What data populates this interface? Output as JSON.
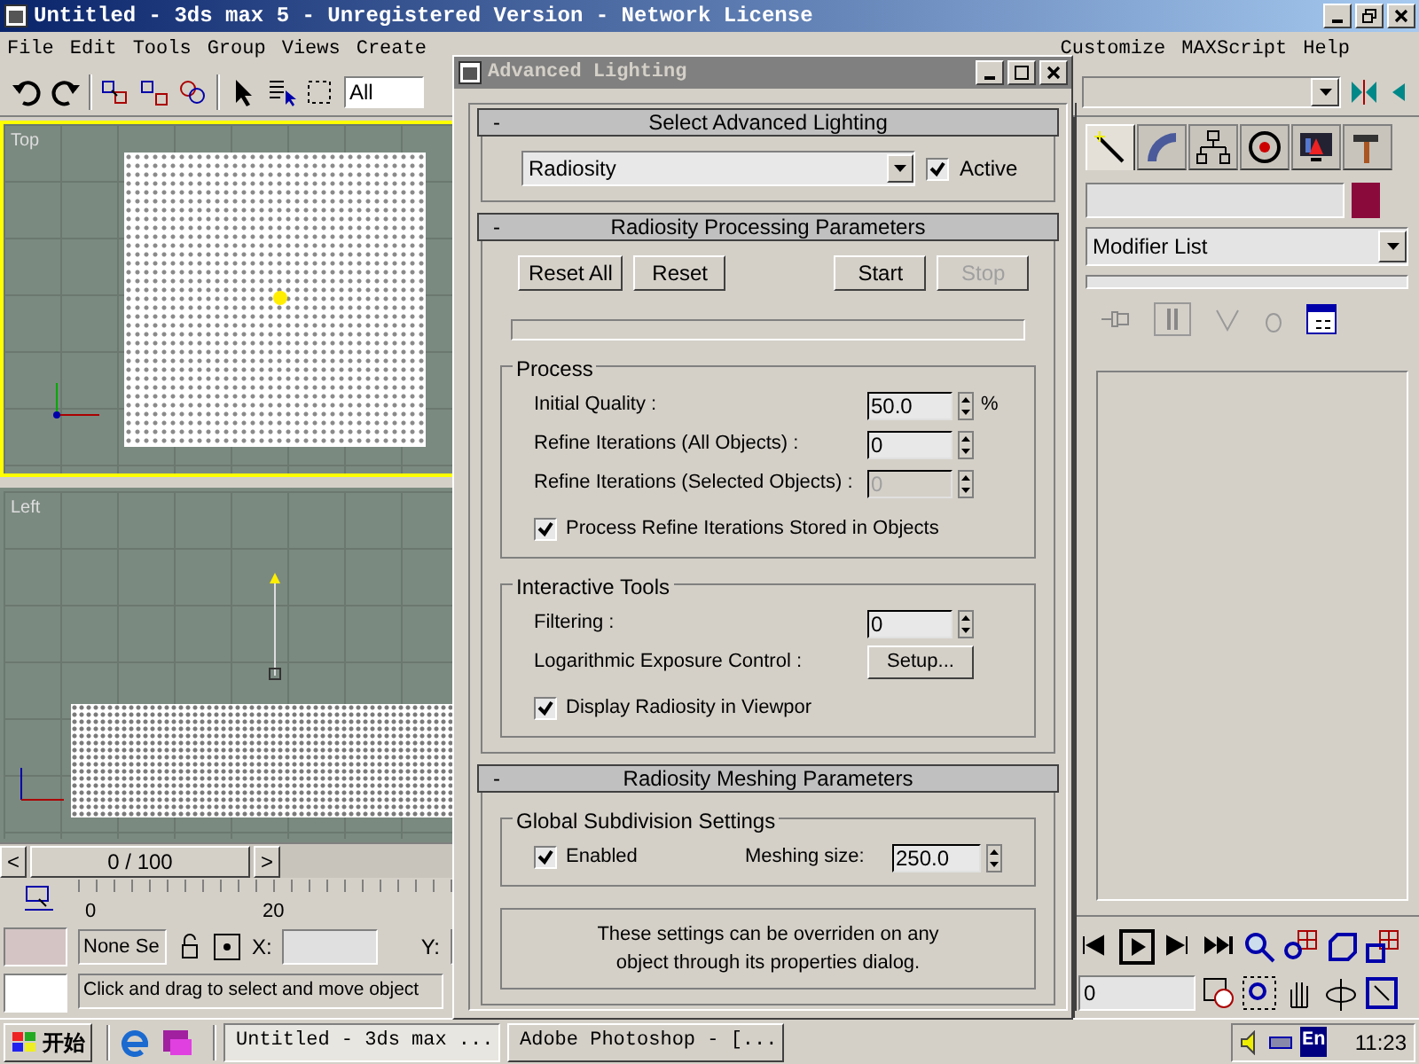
{
  "window": {
    "title": "Untitled - 3ds max 5 - Unregistered Version - Network License"
  },
  "menu": [
    "File",
    "Edit",
    "Tools",
    "Group",
    "Views",
    "Create",
    "Customize",
    "MAXScript",
    "Help"
  ],
  "toolbar": {
    "selection_filter": "All"
  },
  "viewports": [
    {
      "label": "Top",
      "selected": true
    },
    {
      "label": "Left",
      "selected": false
    }
  ],
  "time_slider": {
    "prev": "<",
    "position": "0 / 100",
    "next": ">"
  },
  "track_bar": {
    "ticks": [
      "0",
      "20"
    ]
  },
  "status": {
    "selection": "None Se",
    "x_label": "X:",
    "y_label": "Y:",
    "prompt": "Click and drag to select and move object"
  },
  "command_panel": {
    "tabs": [
      {
        "selected": true
      },
      {
        "selected": false
      },
      {
        "selected": false
      },
      {
        "selected": false
      },
      {
        "selected": false
      },
      {
        "selected": false
      }
    ],
    "modifier_list": "Modifier List"
  },
  "anim_controls": {
    "frame": "0"
  },
  "dialog": {
    "title": "Advanced Lighting",
    "rollouts": [
      {
        "collapse": "-",
        "title": "Select Advanced Lighting",
        "plugin": "Radiosity",
        "active": {
          "label": "Active",
          "checked": true
        }
      },
      {
        "collapse": "-",
        "title": "Radiosity Processing Parameters",
        "buttons": [
          {
            "label": "Reset All",
            "disabled": false
          },
          {
            "label": "Reset",
            "disabled": false
          },
          {
            "label": "Start",
            "disabled": false
          },
          {
            "label": "Stop",
            "disabled": true
          }
        ],
        "progress": {
          "level": 0
        },
        "groups": [
          {
            "title": "Process",
            "rows": [
              {
                "kind": "spinner",
                "label": "Initial Quality :",
                "value": "50.0",
                "unit": "%",
                "disabled": false
              },
              {
                "kind": "spinner",
                "label": "Refine Iterations (All Objects) :",
                "value": "0",
                "disabled": false
              },
              {
                "kind": "spinner",
                "label": "Refine Iterations (Selected Objects) :",
                "value": "0",
                "disabled": true
              },
              {
                "kind": "checkbox",
                "label": "Process Refine Iterations Stored in Objects",
                "checked": true
              }
            ]
          },
          {
            "title": "Interactive Tools",
            "rows": [
              {
                "kind": "spinner",
                "label": "Filtering :",
                "value": "0",
                "disabled": false
              },
              {
                "kind": "button",
                "label": "Logarithmic Exposure Control :",
                "button": "Setup..."
              },
              {
                "kind": "checkbox",
                "label": "Display Radiosity in Viewpor",
                "checked": true
              }
            ]
          }
        ]
      },
      {
        "collapse": "-",
        "title": "Radiosity Meshing Parameters",
        "groups": [
          {
            "title": "Global Subdivision Settings",
            "rows": [
              {
                "kind": "check_spinner",
                "label": "Enabled",
                "checked": true,
                "spinner_label": "Meshing size:",
                "value": "250.0"
              }
            ]
          }
        ],
        "note": "These settings can be overriden on any object through its properties dialog."
      }
    ]
  },
  "taskbar": {
    "start": "开始",
    "tasks": [
      {
        "label": "Untitled - 3ds max ...",
        "selected": true
      },
      {
        "label": "Adobe Photoshop - [...",
        "selected": false
      }
    ],
    "language": "En",
    "clock": "11:23"
  }
}
